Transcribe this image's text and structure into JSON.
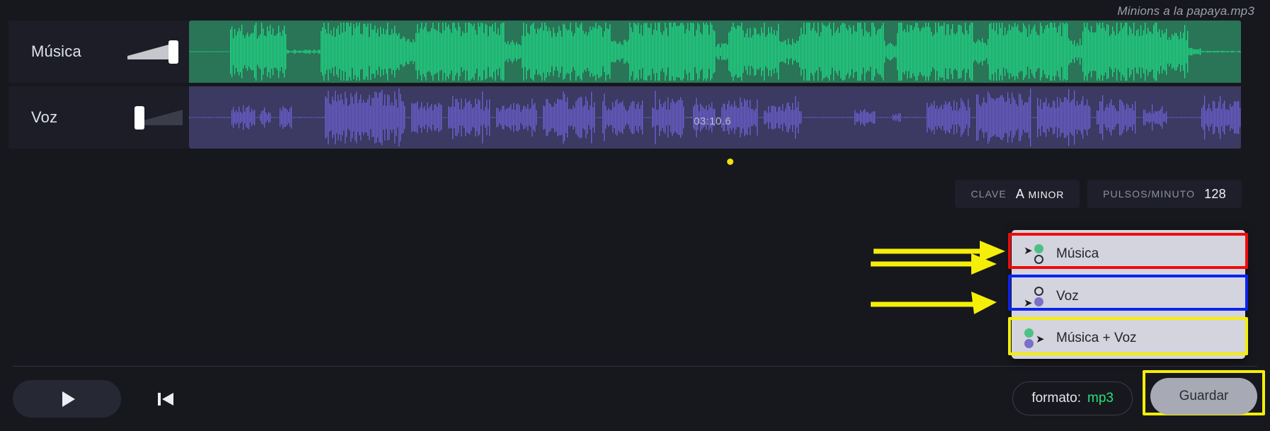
{
  "window": {
    "file_title": "Minions a la papaya.mp3",
    "background_color": "#17181d"
  },
  "tracks": [
    {
      "name": "Música",
      "wave_color": "#1fe089",
      "panel_color": "#2a7457",
      "volume_percent": 100
    },
    {
      "name": "Voz",
      "wave_color": "#6f63d8",
      "panel_color": "#3c3962",
      "volume_percent": 0
    }
  ],
  "timeline": {
    "time_label": "03:10.6",
    "cursor_color": "#f2e00e"
  },
  "meta": {
    "key": {
      "label": "CLAVE",
      "value_main": "A",
      "value_suffix": "MINOR"
    },
    "bpm": {
      "label": "PULSOS/MINUTO",
      "value": "128"
    }
  },
  "dropdown": {
    "items": [
      {
        "label": "Música",
        "icon": "stem-music-icon"
      },
      {
        "label": "Voz",
        "icon": "stem-voice-icon"
      },
      {
        "label": "Música + Voz",
        "icon": "stem-music-voice-icon"
      }
    ]
  },
  "transport": {
    "play_icon": "play-icon",
    "restart_icon": "skip-to-start-icon"
  },
  "footer": {
    "format_label": "formato:",
    "format_value": "mp3",
    "save_label": "Guardar"
  },
  "annotations": {
    "highlight_red": "#ef0b0b",
    "highlight_blue": "#0b23ef",
    "highlight_yellow": "#f5ee09",
    "arrow_color": "#f5ee09"
  }
}
